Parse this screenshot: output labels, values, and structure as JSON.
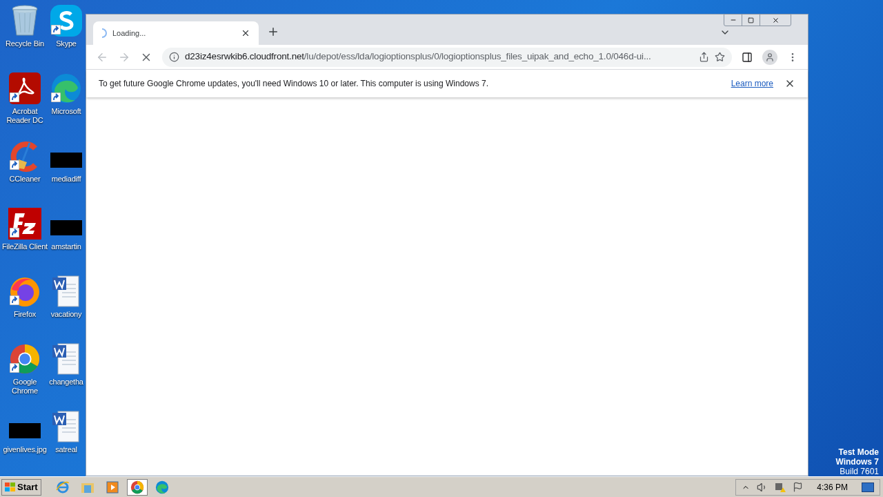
{
  "desktop": {
    "columns": [
      [
        {
          "label": "Recycle Bin",
          "kind": "recycle",
          "shortcut": false
        },
        {
          "label": "Acrobat Reader DC",
          "kind": "acrobat",
          "shortcut": true
        },
        {
          "label": "CCleaner",
          "kind": "ccleaner",
          "shortcut": true
        },
        {
          "label": "FileZilla Client",
          "kind": "filezilla",
          "shortcut": true
        },
        {
          "label": "Firefox",
          "kind": "firefox",
          "shortcut": true
        },
        {
          "label": "Google Chrome",
          "kind": "chrome",
          "shortcut": true
        },
        {
          "label": "givenlives.jpg",
          "kind": "thumb",
          "shortcut": false
        }
      ],
      [
        {
          "label": "Skype",
          "kind": "skype",
          "shortcut": true
        },
        {
          "label": "Microsoft",
          "kind": "edge",
          "shortcut": true
        },
        {
          "label": "mediadiff",
          "kind": "thumb",
          "shortcut": false
        },
        {
          "label": "amstartin",
          "kind": "thumb",
          "shortcut": false
        },
        {
          "label": "vacationy",
          "kind": "word",
          "shortcut": false
        },
        {
          "label": "changetha",
          "kind": "word",
          "shortcut": false
        },
        {
          "label": "satreal",
          "kind": "word",
          "shortcut": false
        }
      ]
    ],
    "test_mode": [
      "Test Mode",
      "Windows 7",
      "Build 7601"
    ]
  },
  "browser": {
    "tabs": [
      {
        "title": "Loading...",
        "loading": true,
        "selected": true
      }
    ],
    "address": {
      "host": "d23iz4esrwkib6.cloudfront.net",
      "path": "/lu/depot/ess/lda/logioptionsplus/0/logioptionsplus_files_uipak_and_echo_1.0/046d-ui..."
    },
    "infobar": {
      "message": "To get future Google Chrome updates, you'll need Windows 10 or later. This computer is using Windows 7.",
      "link": "Learn more"
    }
  },
  "taskbar": {
    "start": "Start",
    "apps": [
      {
        "kind": "ie",
        "selected": false
      },
      {
        "kind": "explorer",
        "selected": false
      },
      {
        "kind": "media",
        "selected": false
      },
      {
        "kind": "chrome",
        "selected": true
      },
      {
        "kind": "edge",
        "selected": false
      }
    ],
    "clock": "4:36 PM"
  }
}
